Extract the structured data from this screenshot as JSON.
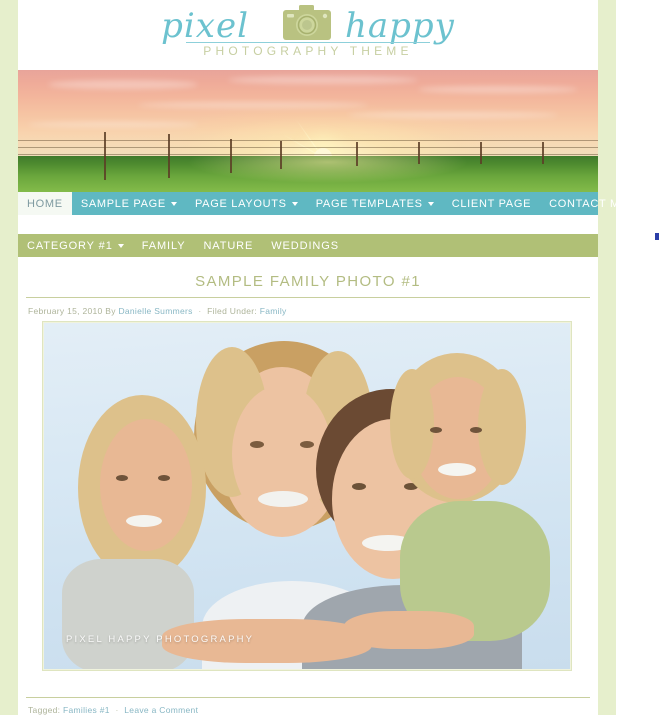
{
  "site": {
    "logo": {
      "word_left": "pixel",
      "word_right": "happy",
      "tagline": "PHOTOGRAPHY THEME",
      "icon": "camera-icon"
    },
    "banner_alt": "sunset-field-fence-banner"
  },
  "nav_primary": {
    "items": [
      {
        "label": "HOME",
        "current": true,
        "has_dropdown": false
      },
      {
        "label": "SAMPLE PAGE",
        "current": false,
        "has_dropdown": true
      },
      {
        "label": "PAGE LAYOUTS",
        "current": false,
        "has_dropdown": true
      },
      {
        "label": "PAGE TEMPLATES",
        "current": false,
        "has_dropdown": true
      },
      {
        "label": "CLIENT PAGE",
        "current": false,
        "has_dropdown": false
      },
      {
        "label": "CONTACT ME",
        "current": false,
        "has_dropdown": false
      }
    ]
  },
  "nav_secondary": {
    "items": [
      {
        "label": "CATEGORY #1",
        "has_dropdown": true
      },
      {
        "label": "FAMILY",
        "has_dropdown": false
      },
      {
        "label": "NATURE",
        "has_dropdown": false
      },
      {
        "label": "WEDDINGS",
        "has_dropdown": false
      }
    ]
  },
  "post": {
    "title": "SAMPLE FAMILY PHOTO #1",
    "meta": {
      "date": "February 15, 2010",
      "by_label": "By",
      "author": "Danielle Summers",
      "separator": "·",
      "filed_label": "Filed Under:",
      "category": "Family"
    },
    "image": {
      "alt": "family-portrait-photo",
      "watermark": "PIXEL HAPPY PHOTOGRAPHY"
    },
    "footer": {
      "tagged_label": "Tagged:",
      "tag": "Families #1",
      "separator": "·",
      "comment_link": "Leave a Comment"
    }
  },
  "colors": {
    "page_background": "#e6efcc",
    "content_background": "#ffffff",
    "nav_primary": "#5fb8c2",
    "nav_secondary": "#b0c076",
    "accent_teal": "#6cc2cf",
    "accent_green": "#b3bc82",
    "link": "#88b7c4",
    "meta_text": "#aeb49a"
  }
}
